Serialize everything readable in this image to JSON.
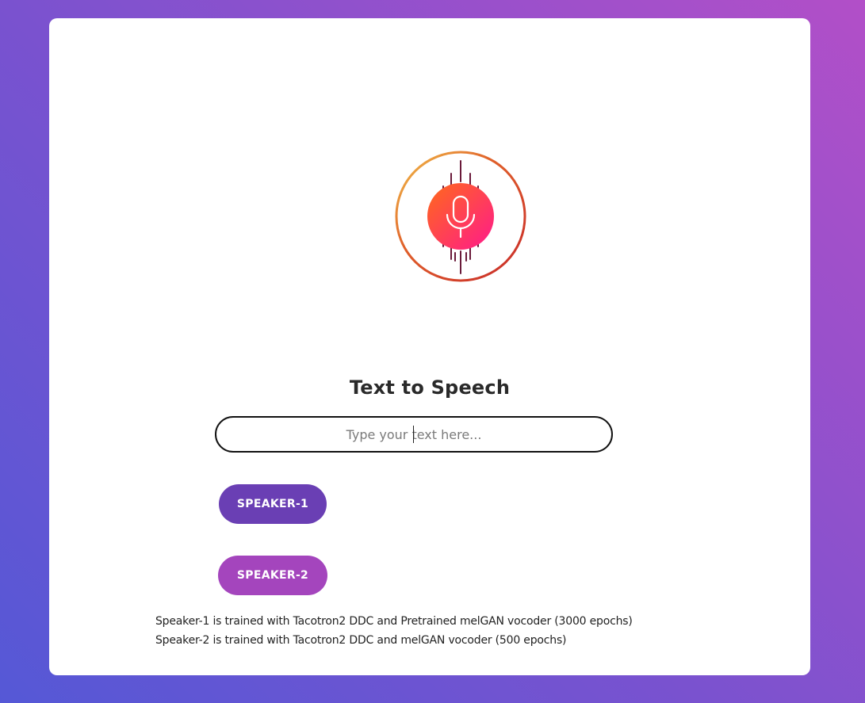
{
  "page": {
    "title": "Text to Speech"
  },
  "input": {
    "placeholder": "Type your text here...",
    "value": ""
  },
  "buttons": [
    {
      "label": "SPEAKER-1",
      "color": "#6a3fb4"
    },
    {
      "label": "SPEAKER-2",
      "color": "#a445bd"
    }
  ],
  "notes": [
    "Speaker-1 is trained with Tacotron2 DDC and Pretrained melGAN vocoder (3000 epochs)",
    "Speaker-2 is trained with Tacotron2 DDC and melGAN vocoder (500 epochs)"
  ],
  "theme": {
    "background_start": "#5558d6",
    "background_end": "#b24fc8",
    "card": "#ffffff",
    "mic_gradient_start": "#ff6a1a",
    "mic_gradient_end": "#ff1a8c",
    "wave_top": "#e0407a",
    "wave_bottom": "#6a2ad0"
  },
  "icons": {
    "hero": "microphone-soundwave-icon"
  }
}
